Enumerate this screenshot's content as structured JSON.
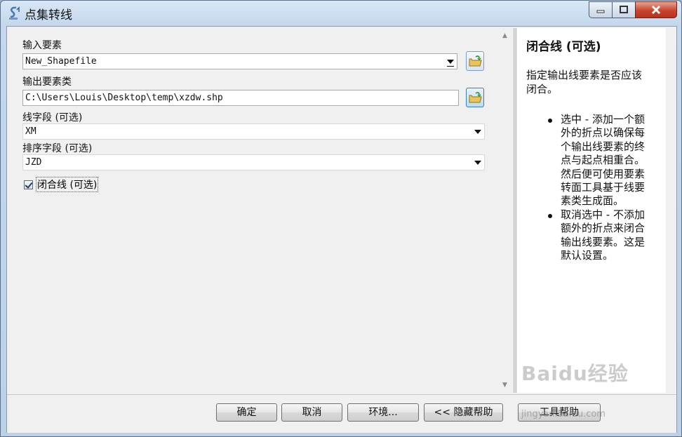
{
  "window": {
    "title": "点集转线"
  },
  "form": {
    "input_features": {
      "label": "输入要素",
      "value": "New_Shapefile"
    },
    "output_features": {
      "label": "输出要素类",
      "value": "C:\\Users\\Louis\\Desktop\\temp\\xzdw.shp"
    },
    "line_field": {
      "label": "线字段 (可选)",
      "value": "XM"
    },
    "sort_field": {
      "label": "排序字段 (可选)",
      "value": "JZD"
    },
    "close_line": {
      "label": "闭合线 (可选)",
      "checked": true
    }
  },
  "help": {
    "title": "闭合线 (可选)",
    "description": "指定输出线要素是否应该闭合。",
    "items": [
      "选中 - 添加一个额外的折点以确保每个输出线要素的终点与起点相重合。然后便可使用要素转面工具基于线要素类生成面。",
      "取消选中 - 不添加额外的折点来闭合输出线要素。这是默认设置。"
    ]
  },
  "buttons": {
    "ok": "确定",
    "cancel": "取消",
    "environments": "环境...",
    "hide_help": "<< 隐藏帮助",
    "tool_help": "工具帮助"
  },
  "watermark": {
    "logo": "Baidu经验",
    "url": "jingyan.baidu.com"
  }
}
